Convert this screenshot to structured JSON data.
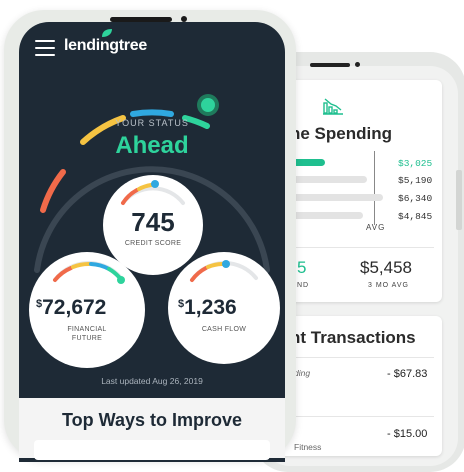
{
  "app": {
    "logo": "lendingtree"
  },
  "status": {
    "label": "YOUR STATUS",
    "value": "Ahead"
  },
  "credit": {
    "score": "745",
    "label": "CREDIT SCORE"
  },
  "financial_future": {
    "currency": "$",
    "amount": "72,672",
    "label_line1": "FINANCIAL",
    "label_line2": "FUTURE"
  },
  "cash_flow": {
    "currency": "$",
    "amount": "1,236",
    "label": "CASH FLOW"
  },
  "last_updated": "Last updated Aug 26, 2019",
  "improve": {
    "title": "Top Ways to Improve"
  },
  "spending": {
    "title": "ne Spending",
    "bars": [
      {
        "value": "$3,025",
        "highlight": true
      },
      {
        "value": "$5,190",
        "highlight": false
      },
      {
        "value": "$6,340",
        "highlight": false
      },
      {
        "value": "$4,845",
        "highlight": false
      }
    ],
    "avg_label": "AVG",
    "current_value": "5",
    "current_label": "ND",
    "avg_value": "$5,458",
    "avg_value_label": "3 MO AVG"
  },
  "transactions": {
    "title": "nt Transactions",
    "items": [
      {
        "name": "ding",
        "amount": "- $67.83"
      },
      {
        "name": "Fitness",
        "amount": "- $15.00"
      }
    ]
  },
  "colors": {
    "navy": "#1e2a36",
    "green": "#2ed39c",
    "accent_green": "#1fbf8f"
  },
  "icons": [
    "menu-icon",
    "leaf-icon",
    "spending-chart-icon"
  ]
}
